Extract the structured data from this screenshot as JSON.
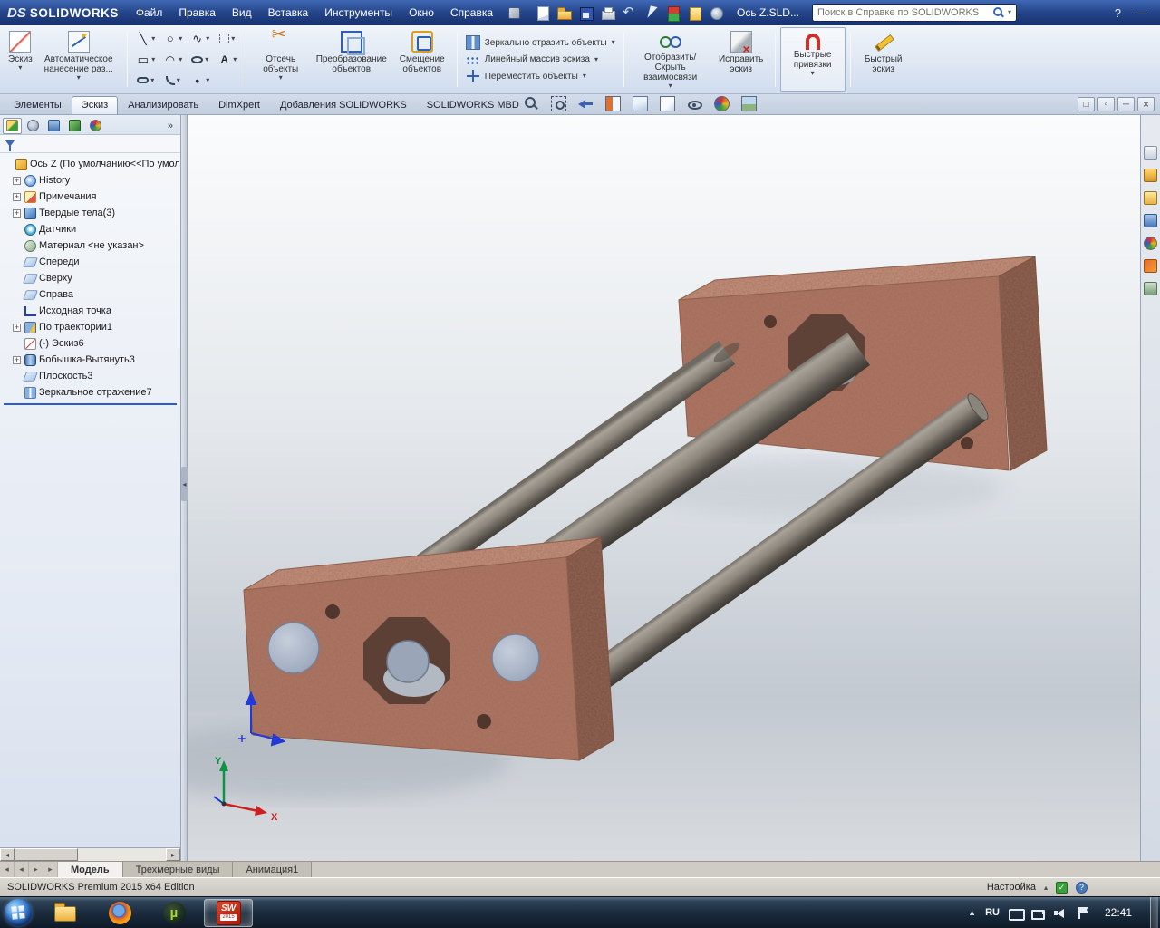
{
  "titlebar": {
    "logo_mark": "DS",
    "logo_text": "SOLIDWORKS",
    "menus": [
      {
        "label": "Файл"
      },
      {
        "label": "Правка"
      },
      {
        "label": "Вид"
      },
      {
        "label": "Вставка"
      },
      {
        "label": "Инструменты"
      },
      {
        "label": "Окно"
      },
      {
        "label": "Справка"
      }
    ],
    "doc_title": "Ось Z.SLD...",
    "search_placeholder": "Поиск в Справке по SOLIDWORKS",
    "help_glyph": "?",
    "minimize_glyph": "—"
  },
  "ribbon": {
    "sketch": "Эскиз",
    "smart_dimension": "Автоматическое нанесение раз...",
    "grid_tools": [
      {
        "icon": "line-icon"
      },
      {
        "icon": "circle-icon"
      },
      {
        "icon": "spline-icon"
      },
      {
        "icon": "selection-box-icon"
      },
      {
        "icon": "rectangle-icon"
      },
      {
        "icon": "arc-icon"
      },
      {
        "icon": "ellipse-icon"
      },
      {
        "icon": "sketch-text-icon"
      },
      {
        "icon": "slot-icon"
      },
      {
        "icon": "fillet-icon"
      },
      {
        "icon": "point-icon"
      }
    ],
    "trim": "Отсечь объекты",
    "convert": "Преобразование объектов",
    "offset": "Смещение объектов",
    "stacked": [
      {
        "label": "Зеркально отразить объекты",
        "icon": "mirror-entities-icon"
      },
      {
        "label": "Линейный массив эскиза",
        "icon": "linear-pattern-icon"
      },
      {
        "label": "Переместить объекты",
        "icon": "move-entities-icon"
      }
    ],
    "display_relations": "Отобразить/Скрыть взаимосвязи",
    "repair": "Исправить эскиз",
    "quick_snaps": "Быстрые привязки",
    "rapid_sketch": "Быстрый эскиз"
  },
  "command_tabs": {
    "items": [
      {
        "label": "Элементы"
      },
      {
        "label": "Эскиз",
        "active": true
      },
      {
        "label": "Анализировать"
      },
      {
        "label": "DimXpert"
      },
      {
        "label": "Добавления SOLIDWORKS"
      },
      {
        "label": "SOLIDWORKS MBD"
      }
    ]
  },
  "headsup": {
    "items": [
      {
        "icon": "zoom-fit-icon"
      },
      {
        "icon": "zoom-area-icon"
      },
      {
        "icon": "previous-view-icon"
      },
      {
        "icon": "section-view-icon"
      },
      {
        "icon": "view-orientation-icon"
      },
      {
        "icon": "display-style-icon"
      },
      {
        "icon": "hide-items-icon"
      },
      {
        "icon": "appearances-icon"
      },
      {
        "icon": "scene-icon"
      }
    ]
  },
  "feature_tree": {
    "collapse_glyph": "»",
    "items": [
      {
        "label": "Ось Z  (По умолчанию<<По умолча",
        "icon": "part-icon",
        "plus": "",
        "level": 0
      },
      {
        "label": "History",
        "icon": "history-icon",
        "plus": "+",
        "level": 1
      },
      {
        "label": "Примечания",
        "icon": "annotations-icon",
        "plus": "+",
        "level": 1
      },
      {
        "label": "Твердые тела(3)",
        "icon": "solid-bodies-icon",
        "plus": "+",
        "level": 1
      },
      {
        "label": "Датчики",
        "icon": "sensors-icon",
        "plus": "",
        "level": 1
      },
      {
        "label": "Материал <не указан>",
        "icon": "material-icon",
        "plus": "",
        "level": 1
      },
      {
        "label": "Спереди",
        "icon": "plane-icon",
        "plus": "",
        "level": 1
      },
      {
        "label": "Сверху",
        "icon": "plane-icon",
        "plus": "",
        "level": 1
      },
      {
        "label": "Справа",
        "icon": "plane-icon",
        "plus": "",
        "level": 1
      },
      {
        "label": "Исходная точка",
        "icon": "origin-icon",
        "plus": "",
        "level": 1
      },
      {
        "label": "По траектории1",
        "icon": "sweep-icon",
        "plus": "+",
        "level": 1
      },
      {
        "label": "(-) Эскиз6",
        "icon": "sketch-icon",
        "plus": "",
        "level": 1
      },
      {
        "label": "Бобышка-Вытянуть3",
        "icon": "boss-extrude-icon",
        "plus": "+",
        "level": 1
      },
      {
        "label": "Плоскость3",
        "icon": "plane-icon",
        "plus": "",
        "level": 1
      },
      {
        "label": "Зеркальное отражение7",
        "icon": "mirror-feature-icon",
        "plus": "",
        "level": 1
      }
    ]
  },
  "panel_tabs": {
    "items": [
      {
        "icon": "featuremanager-tab-icon",
        "active": true
      },
      {
        "icon": "propertymanager-tab-icon"
      },
      {
        "icon": "configurationmanager-tab-icon"
      },
      {
        "icon": "dimxpertmanager-tab-icon"
      },
      {
        "icon": "displaymanager-tab-icon"
      }
    ]
  },
  "quickbar": {
    "items": [
      {
        "icon": "new-document-icon"
      },
      {
        "icon": "open-document-icon"
      },
      {
        "icon": "save-icon"
      },
      {
        "icon": "print-icon"
      },
      {
        "icon": "undo-icon"
      },
      {
        "icon": "select-icon"
      },
      {
        "icon": "rebuild-icon"
      },
      {
        "icon": "file-properties-icon"
      },
      {
        "icon": "options-icon"
      }
    ]
  },
  "task_pane": {
    "items": [
      {
        "icon": "task-pane-resources-icon"
      },
      {
        "icon": "design-library-icon"
      },
      {
        "icon": "file-explorer-icon"
      },
      {
        "icon": "view-palette-icon"
      },
      {
        "icon": "appearances-scenes-icon"
      },
      {
        "icon": "decals-icon"
      },
      {
        "icon": "custom-properties-icon"
      }
    ]
  },
  "viewport": {
    "axis_x": "X",
    "axis_y": "Y"
  },
  "model_tabs": {
    "items": [
      {
        "label": "Модель",
        "active": true
      },
      {
        "label": "Трехмерные виды"
      },
      {
        "label": "Анимация1"
      }
    ]
  },
  "statusbar": {
    "edition": "SOLIDWORKS Premium 2015 x64 Edition",
    "settings": "Настройка"
  },
  "taskbar": {
    "language": "RU",
    "time": "22:41",
    "sw_badge": "SW",
    "sw_year": "2015"
  },
  "colors": {
    "block": "#b27563",
    "rod": "#8b857b",
    "bore": "#9aa5b8",
    "selection": "#2a5ad0",
    "titlebar": "#27488e"
  }
}
